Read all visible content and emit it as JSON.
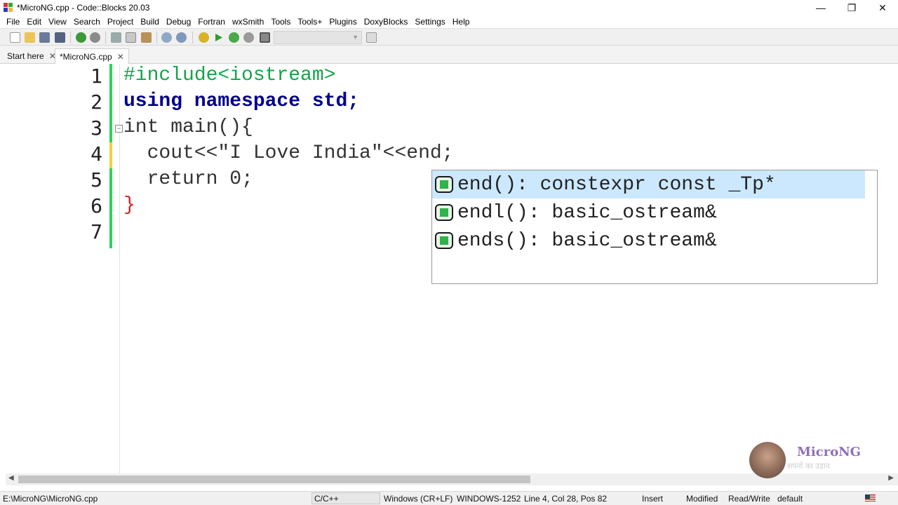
{
  "window": {
    "title": "*MicroNG.cpp - Code::Blocks 20.03",
    "controls": {
      "minimize": "—",
      "restore": "❐",
      "close": "✕"
    }
  },
  "menu": [
    "File",
    "Edit",
    "View",
    "Search",
    "Project",
    "Build",
    "Debug",
    "Fortran",
    "wxSmith",
    "Tools",
    "Tools+",
    "Plugins",
    "DoxyBlocks",
    "Settings",
    "Help"
  ],
  "toolbar": {
    "icons": [
      "new-file-icon",
      "open-icon",
      "save-icon",
      "save-all-icon",
      "undo-icon",
      "redo-icon",
      "cut-icon",
      "copy-icon",
      "paste-icon",
      "find-icon",
      "replace-icon",
      "build-icon",
      "run-icon",
      "build-run-icon",
      "rebuild-icon",
      "abort-icon",
      "notes-icon"
    ],
    "target_value": ""
  },
  "tabs": [
    {
      "label": "Start here",
      "active": false
    },
    {
      "label": "*MicroNG.cpp",
      "active": true
    }
  ],
  "editor": {
    "line_numbers": [
      "1",
      "2",
      "3",
      "4",
      "5",
      "6",
      "7"
    ],
    "lines": [
      "#include<iostream>",
      "using namespace std;",
      "int main(){",
      "  cout<<\"I Love India\"<<end;",
      "  return 0;",
      "}",
      ""
    ]
  },
  "autocomplete": {
    "items": [
      {
        "text": "end(): constexpr const _Tp*",
        "selected": true
      },
      {
        "text": "endl(): basic_ostream&",
        "selected": false
      },
      {
        "text": "ends(): basic_ostream&",
        "selected": false
      }
    ]
  },
  "watermark": {
    "brand": "MicroNG",
    "tagline": "सपनों का उड़ान"
  },
  "status": {
    "path": "E:\\MicroNG\\MicroNG.cpp",
    "language": "C/C++",
    "line_endings": "Windows (CR+LF)",
    "encoding": "WINDOWS-1252",
    "position": "Line 4, Col 28, Pos 82",
    "mode": "Insert",
    "modified": "Modified",
    "access": "Read/Write",
    "profile": "default"
  },
  "colors": {
    "change_bar": "#2fd15a",
    "selection": "#cce8ff",
    "keyword": "#00008b"
  }
}
